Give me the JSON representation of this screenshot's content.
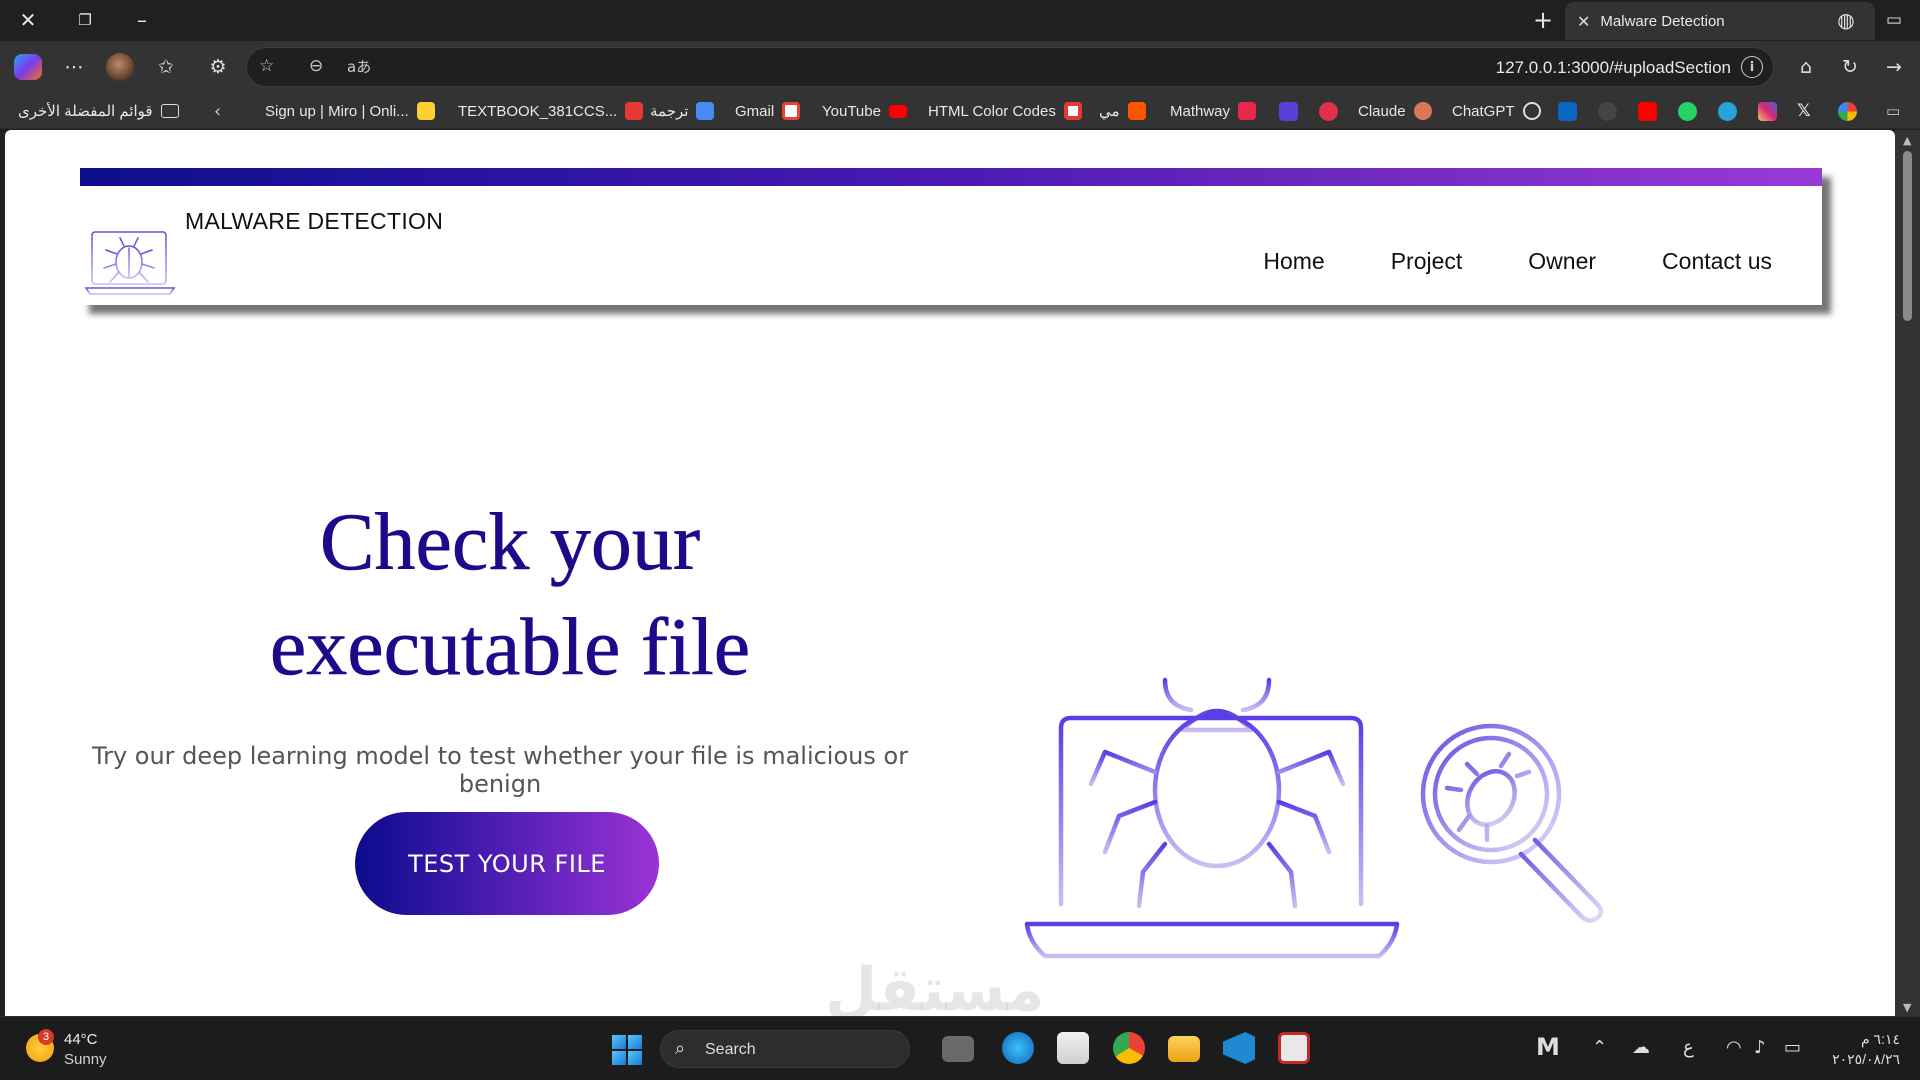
{
  "browser": {
    "tab_title": "Malware Detection",
    "url": "127.0.0.1:3000/#uploadSection",
    "bookmarks": {
      "other_favorites": "قوائم المفضلة الأخرى",
      "items": [
        "Sign up | Miro | Onli...",
        "TEXTBOOK_381CCS...",
        "ترجمة",
        "Gmail",
        "YouTube",
        "HTML Color Codes",
        "مي",
        "Mathway",
        "Claude",
        "ChatGPT"
      ]
    },
    "icons": [
      "close-window-icon",
      "restore-icon",
      "minimize-icon",
      "new-tab-icon",
      "globe-icon",
      "sidebar-icon",
      "copilot-icon",
      "more-icon",
      "profile-avatar",
      "favorites-icon",
      "extensions-icon",
      "star-icon",
      "tracking-icon",
      "read-aloud-icon",
      "info-icon",
      "home-icon",
      "refresh-icon",
      "forward-icon",
      "back-icon"
    ]
  },
  "site": {
    "brand": "MALWARE DETECTION",
    "nav": [
      "Home",
      "Project",
      "Owner",
      "Contact us"
    ],
    "hero": {
      "title_line1": "Check your",
      "title_line2": "executable file",
      "subtitle": "Try our deep learning model to test whether your file is malicious or benign",
      "cta": "TEST YOUR FILE"
    },
    "watermark": "مستقل",
    "colors": {
      "primary": "#1c0a8a",
      "gradient_start": "#0c0b8c",
      "gradient_end": "#9a34d6",
      "art_top": "#5b3ce6",
      "art_bottom": "#cdbcf4"
    }
  },
  "taskbar": {
    "weather": {
      "temp": "44°C",
      "desc": "Sunny",
      "badge": "3"
    },
    "search": "Search",
    "lang": "ع",
    "time": "٦:١٤ م",
    "date": "٢٠٢٥/٠٨/٢٦"
  }
}
